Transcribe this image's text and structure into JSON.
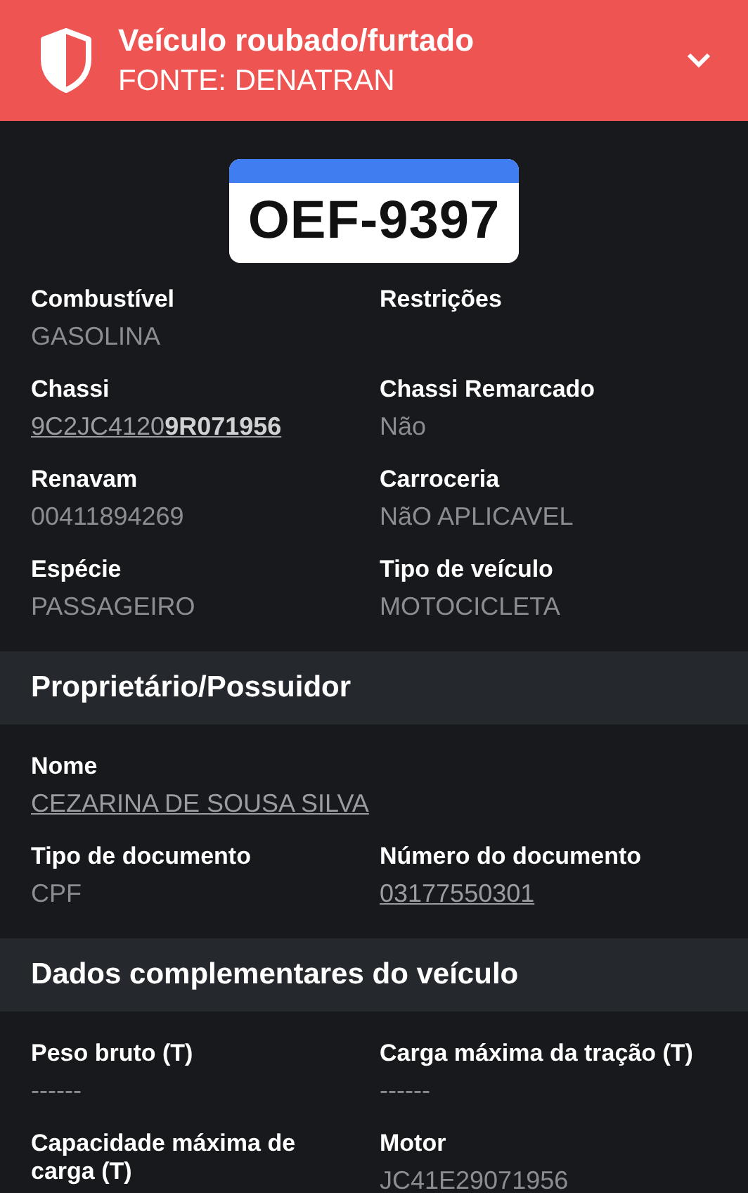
{
  "alert": {
    "title": "Veículo roubado/furtado",
    "source": "FONTE: DENATRAN"
  },
  "plate": {
    "text": "OEF-9397"
  },
  "sections": [
    {
      "rows": [
        [
          {
            "label": "Combustível",
            "value": "GASOLINA",
            "link": false
          },
          {
            "label": "Restrições"
          }
        ],
        [
          {
            "label": "Chassi",
            "value": "9C2JC4120**9R071956**",
            "link": true
          },
          {
            "label": "Chassi Remarcado",
            "value": "Não",
            "link": false
          }
        ],
        [
          {
            "label": "Renavam",
            "value": "00411894269",
            "link": false
          },
          {
            "label": "Carroceria",
            "value": "NãO APLICAVEL",
            "link": false
          }
        ],
        [
          {
            "label": "Espécie",
            "value": "PASSAGEIRO",
            "link": false
          },
          {
            "label": "Tipo de veículo",
            "value": "MOTOCICLETA",
            "link": false
          }
        ]
      ]
    },
    {
      "title": "Proprietário/Possuidor",
      "rows": [
        [
          {
            "label": "Nome",
            "value": "CEZARINA DE SOUSA SILVA",
            "link": true
          }
        ],
        [
          {
            "label": "Tipo de documento",
            "value": "CPF",
            "link": false
          },
          {
            "label": "Número do documento",
            "value": "03177550301",
            "link": true
          }
        ]
      ]
    },
    {
      "title": "Dados complementares do veículo",
      "rows": [
        [
          {
            "label": "Peso bruto (T)",
            "value": "------",
            "link": false
          },
          {
            "label": "Carga máxima da tração (T)",
            "value": "------",
            "link": false
          }
        ],
        [
          {
            "label": "Capacidade máxima de carga (T)"
          },
          {
            "label": "Motor",
            "value": "JC41E29071956",
            "link": false
          }
        ]
      ]
    }
  ]
}
